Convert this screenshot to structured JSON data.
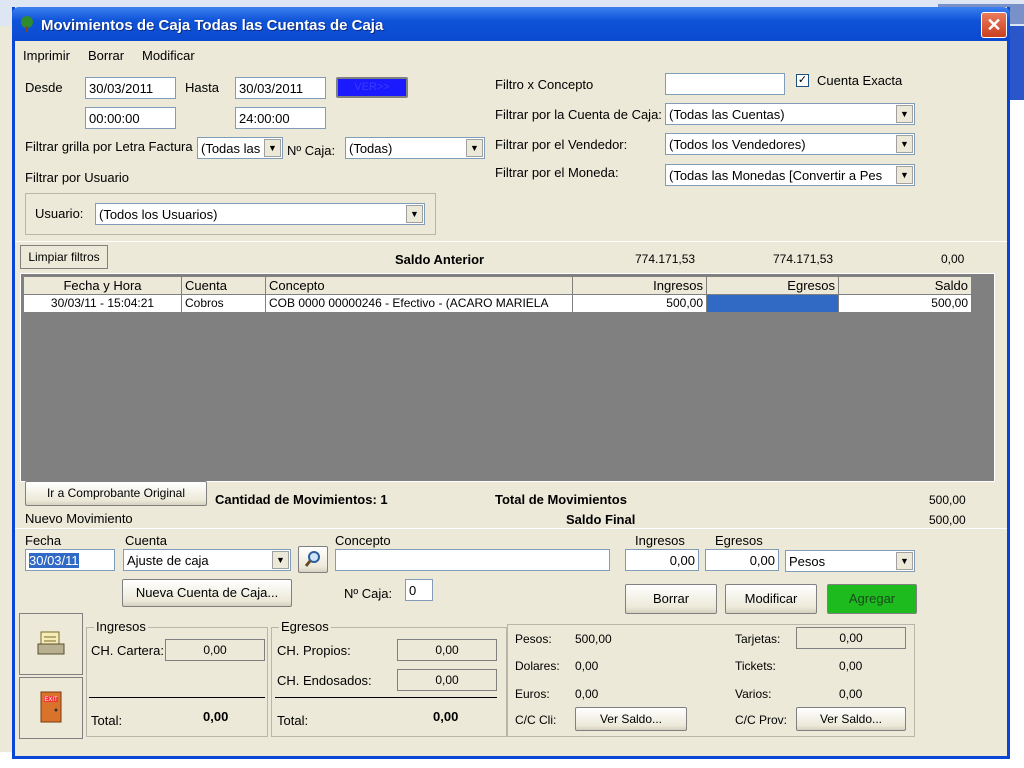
{
  "window": {
    "title": "Movimientos de Caja Todas las Cuentas de Caja",
    "close": "✕"
  },
  "menu": [
    "Imprimir",
    "Borrar",
    "Modificar"
  ],
  "filters": {
    "desde_label": "Desde",
    "desde_date": "30/03/2011",
    "desde_time": "00:00:00",
    "hasta_label": "Hasta",
    "hasta_date": "30/03/2011",
    "hasta_time": "24:00:00",
    "ver_button": "VER>>",
    "letra_label": "Filtrar grilla por Letra Factura",
    "letra_value": "(Todas las",
    "caja_label": "Nº Caja:",
    "caja_value": "(Todas)",
    "usuario_section": "Filtrar por Usuario",
    "usuario_label": "Usuario:",
    "usuario_value": "(Todos los Usuarios)",
    "concepto_label": "Filtro x Concepto",
    "concepto_value": "",
    "cuenta_exacta_label": "Cuenta Exacta",
    "cuenta_exacta_checked": "✓",
    "cuenta_caja_label": "Filtrar por la Cuenta de Caja:",
    "cuenta_caja_value": "(Todas las Cuentas)",
    "vendedor_label": "Filtrar por el Vendedor:",
    "vendedor_value": "(Todos los Vendedores)",
    "moneda_label": "Filtrar por el Moneda:",
    "moneda_value": "(Todas las Monedas [Convertir a Pes"
  },
  "saldo_anterior": {
    "clear_button": "Limpiar filtros",
    "label": "Saldo Anterior",
    "ingresos": "774.171,53",
    "egresos": "774.171,53",
    "saldo": "0,00"
  },
  "grid": {
    "columns": [
      "Fecha y Hora",
      "Cuenta",
      "Concepto",
      "Ingresos",
      "Egresos",
      "Saldo"
    ],
    "rows": [
      {
        "fecha": "30/03/11 - 15:04:21",
        "cuenta": "Cobros",
        "concepto": "COB  0000 00000246 - Efectivo - (ACARO MARIELA",
        "ingresos": "500,00",
        "egresos": "",
        "saldo": "500,00"
      }
    ]
  },
  "totals": {
    "goto_button": "Ir a Comprobante Original",
    "cantidad": "Cantidad de Movimientos: 1",
    "total_label": "Total de Movimientos",
    "total_value": "500,00",
    "saldo_final_label": "Saldo Final",
    "saldo_final_value": "500,00"
  },
  "nuevo": {
    "section": "Nuevo Movimiento",
    "fecha_label": "Fecha",
    "fecha_value": "30/03/11",
    "cuenta_label": "Cuenta",
    "cuenta_value": "Ajuste de caja",
    "concepto_label": "Concepto",
    "concepto_value": "",
    "ingresos_label": "Ingresos",
    "ingresos_value": "0,00",
    "egresos_label": "Egresos",
    "egresos_value": "0,00",
    "moneda_value": "Pesos",
    "nueva_cuenta_button": "Nueva Cuenta de Caja...",
    "caja_label": "Nº Caja:",
    "caja_value": "0",
    "borrar_button": "Borrar",
    "modificar_button": "Modificar",
    "agregar_button": "Agregar"
  },
  "summary": {
    "ingresos_title": "Ingresos",
    "ch_cartera_label": "CH. Cartera:",
    "ch_cartera_value": "0,00",
    "ingresos_total_label": "Total:",
    "ingresos_total_value": "0,00",
    "egresos_title": "Egresos",
    "ch_propios_label": "CH. Propios:",
    "ch_propios_value": "0,00",
    "ch_endosados_label": "CH. Endosados:",
    "ch_endosados_value": "0,00",
    "egresos_total_label": "Total:",
    "egresos_total_value": "0,00",
    "pesos_label": "Pesos:",
    "pesos_value": "500,00",
    "dolares_label": "Dolares:",
    "dolares_value": "0,00",
    "euros_label": "Euros:",
    "euros_value": "0,00",
    "cc_cli_label": "C/C Cli:",
    "cc_cli_button": "Ver Saldo...",
    "tarjetas_label": "Tarjetas:",
    "tarjetas_value": "0,00",
    "tickets_label": "Tickets:",
    "tickets_value": "0,00",
    "varios_label": "Varios:",
    "varios_value": "0,00",
    "cc_prov_label": "C/C Prov:",
    "cc_prov_button": "Ver Saldo...",
    "exit_icon_text": "EXIT"
  },
  "colors": {
    "title_bar": "#0b4ad0",
    "ver_button": "#1a1aff",
    "agregar_button": "#1dbb1d",
    "selection": "#316ac5"
  }
}
